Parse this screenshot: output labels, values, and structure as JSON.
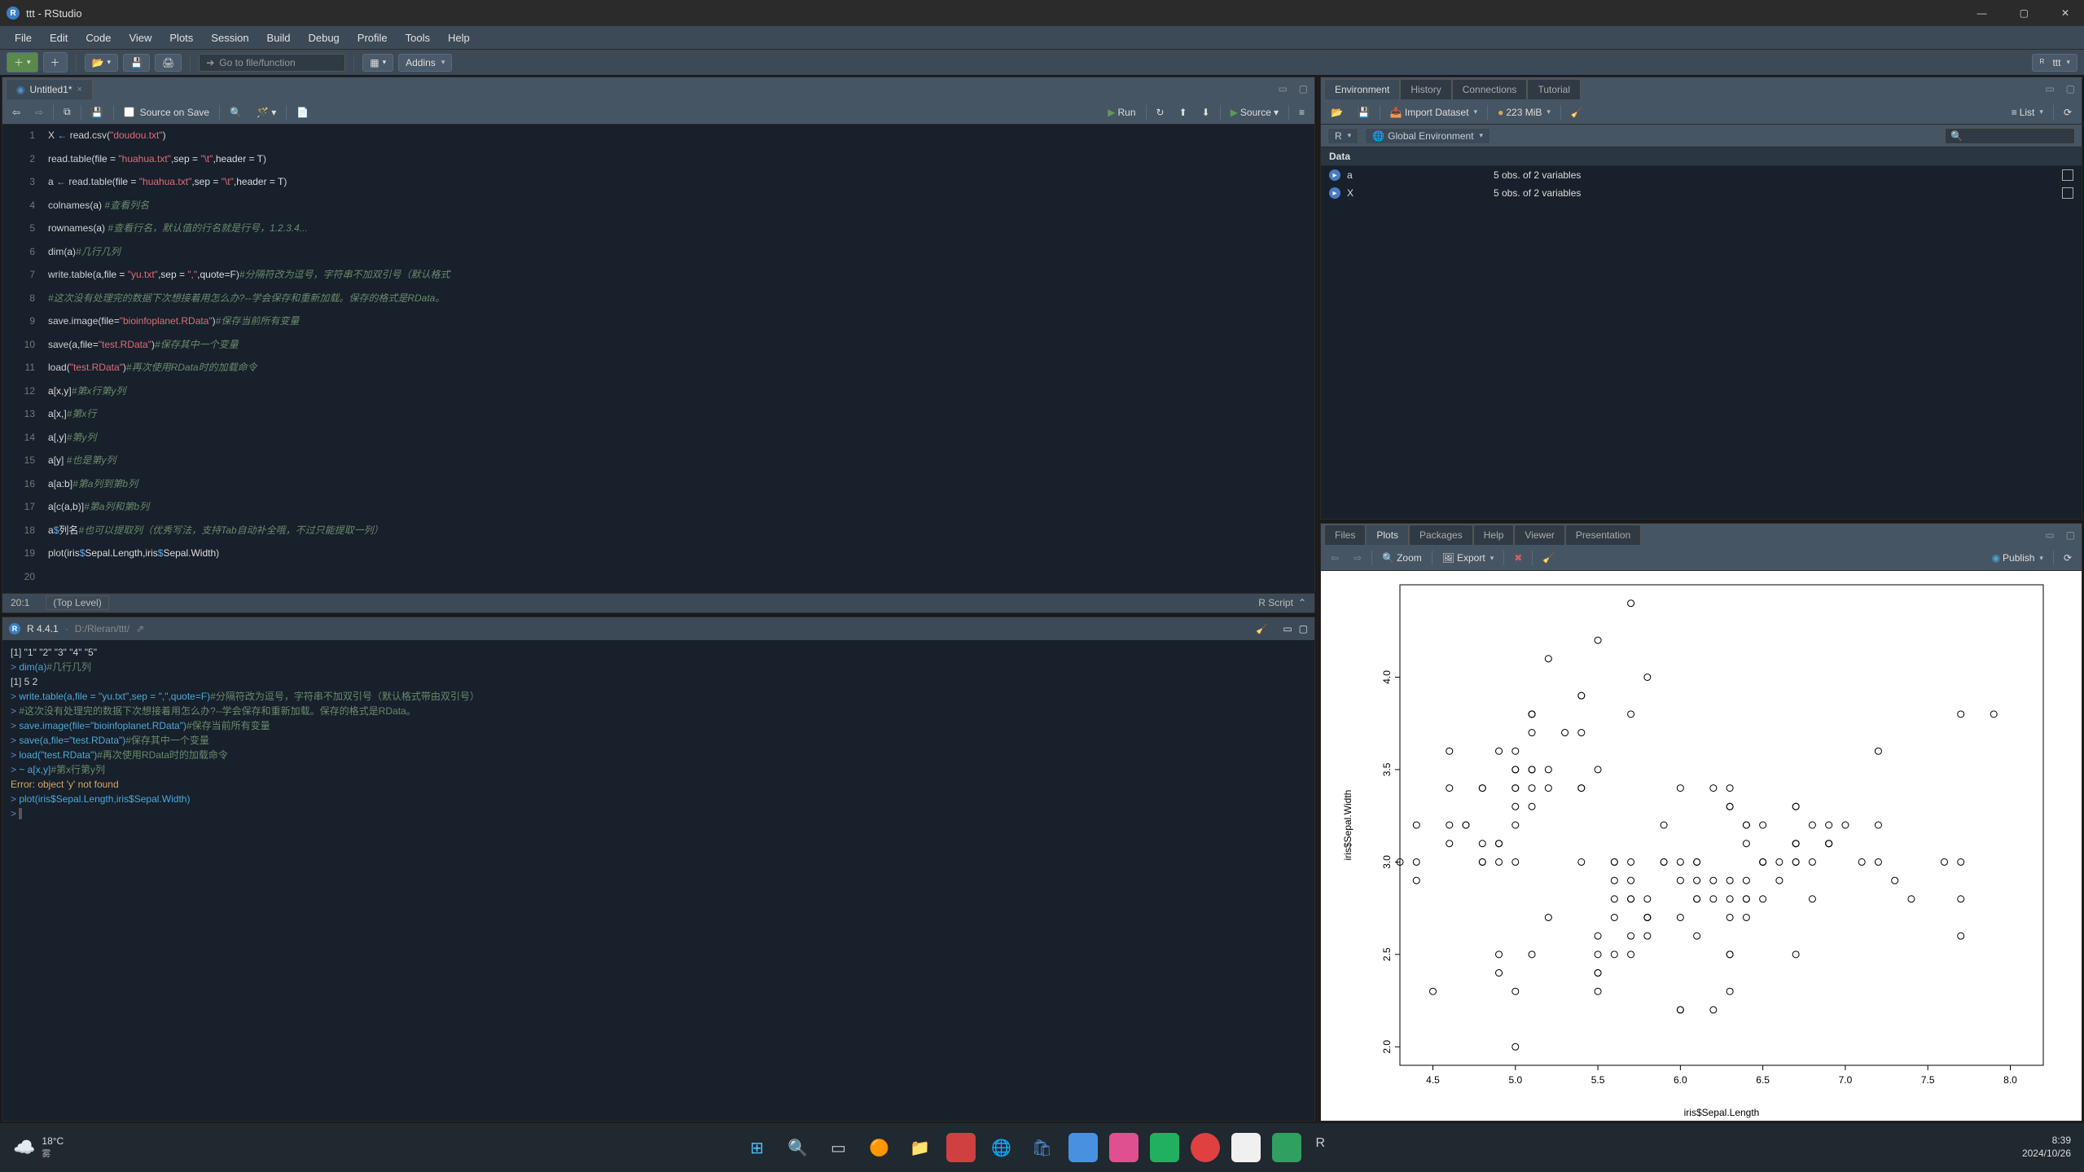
{
  "window": {
    "title": "ttt - RStudio"
  },
  "menu": [
    "File",
    "Edit",
    "Code",
    "View",
    "Plots",
    "Session",
    "Build",
    "Debug",
    "Profile",
    "Tools",
    "Help"
  ],
  "toolbar": {
    "goto_placeholder": "Go to file/function",
    "addins": "Addins",
    "project": "ttt"
  },
  "source": {
    "tab": "Untitled1*",
    "save_on_source": "Source on Save",
    "run": "Run",
    "source_btn": "Source",
    "status_pos": "20:1",
    "status_scope": "(Top Level)",
    "status_type": "R Script",
    "lines": [
      {
        "n": 1,
        "html": "<span class='c-kw'>X</span> <span class='c-op'>←</span> <span class='c-fn'>read.csv</span><span class='c-par'>(</span><span class='c-str'>\"doudou.txt\"</span><span class='c-par'>)</span>"
      },
      {
        "n": 2,
        "html": "<span class='c-fn'>read.table</span><span class='c-par'>(</span>file = <span class='c-str'>\"huahua.txt\"</span>,sep = <span class='c-str'>\"\\t\"</span>,header = T<span class='c-par'>)</span>"
      },
      {
        "n": 3,
        "html": "<span class='c-kw'>a</span> <span class='c-op'>←</span> <span class='c-fn'>read.table</span><span class='c-par'>(</span>file = <span class='c-str'>\"huahua.txt\"</span>,sep = <span class='c-str'>\"\\t\"</span>,header = T<span class='c-par'>)</span>"
      },
      {
        "n": 4,
        "html": "<span class='c-fn'>colnames</span><span class='c-par'>(</span>a<span class='c-par'>)</span> <span class='c-cmt'>#查看列名</span>"
      },
      {
        "n": 5,
        "html": "<span class='c-fn'>rownames</span><span class='c-par'>(</span>a<span class='c-par'>)</span> <span class='c-cmt'>#查看行名，默认值的行名就是行号，1.2.3.4...</span>"
      },
      {
        "n": 6,
        "html": "<span class='c-fn'>dim</span><span class='c-par'>(</span>a<span class='c-par'>)</span><span class='c-cmt'>#几行几列</span>"
      },
      {
        "n": 7,
        "html": "<span class='c-fn'>write.table</span><span class='c-par'>(</span>a,file = <span class='c-str'>\"yu.txt\"</span>,sep = <span class='c-str'>\",\"</span>,quote=F<span class='c-par'>)</span><span class='c-cmt'>#分隔符改为逗号，字符串不加双引号（默认格式</span>"
      },
      {
        "n": 8,
        "html": "<span class='c-cmt'>#这次没有处理完的数据下次想接着用怎么办?--学会保存和重新加载。保存的格式是RData。</span>"
      },
      {
        "n": 9,
        "html": "<span class='c-fn'>save.image</span><span class='c-par'>(</span>file=<span class='c-str'>\"bioinfoplanet.RData\"</span><span class='c-par'>)</span><span class='c-cmt'>#保存当前所有变量</span>"
      },
      {
        "n": 10,
        "html": "<span class='c-fn'>save</span><span class='c-par'>(</span>a,file=<span class='c-str'>\"test.RData\"</span><span class='c-par'>)</span><span class='c-cmt'>#保存其中一个变量</span>"
      },
      {
        "n": 11,
        "html": "<span class='c-fn'>load</span><span class='c-par'>(</span><span class='c-str'>\"test.RData\"</span><span class='c-par'>)</span><span class='c-cmt'>#再次使用RData时的加载命令</span>"
      },
      {
        "n": 12,
        "html": "a<span class='c-par'>[</span>x,y<span class='c-par'>]</span><span class='c-cmt'>#第x行第y列</span>"
      },
      {
        "n": 13,
        "html": "a<span class='c-par'>[</span>x,<span class='c-par'>]</span><span class='c-cmt'>#第x行</span>"
      },
      {
        "n": 14,
        "html": "a<span class='c-par'>[</span>,y<span class='c-par'>]</span><span class='c-cmt'>#第y列</span>"
      },
      {
        "n": 15,
        "html": "a<span class='c-par'>[</span>y<span class='c-par'>]</span> <span class='c-cmt'>#也是第y列</span>"
      },
      {
        "n": 16,
        "html": "a<span class='c-par'>[</span>a:b<span class='c-par'>]</span><span class='c-cmt'>#第a列到第b列</span>"
      },
      {
        "n": 17,
        "html": "a<span class='c-par'>[</span><span class='c-fn'>c</span><span class='c-par'>(</span>a,b<span class='c-par'>)]</span><span class='c-cmt'>#第a列和第b列</span>"
      },
      {
        "n": 18,
        "html": "a<span class='c-op'>$</span>列名<span class='c-cmt'>#也可以提取列（优秀写法，支持Tab自动补全哦，不过只能提取一列）</span>"
      },
      {
        "n": 19,
        "html": "<span class='c-fn'>plot</span><span class='c-par'>(</span>iris<span class='c-op'>$</span>Sepal.Length,iris<span class='c-op'>$</span>Sepal.Width<span class='c-par'>)</span>"
      },
      {
        "n": 20,
        "html": " "
      }
    ]
  },
  "console": {
    "version": "R 4.4.1",
    "path": "D:/Rleran/ttt/",
    "lines_html": "<div class='line out'>[1] \"1\" \"2\" \"3\" \"4\" \"5\"</div><div class='line'><span class='pr'>&gt; </span><span class='cmd-blue'>dim(a)</span><span class='green'>#几行几列</span></div><div class='line out'>[1] 5 2</div><div class='line'><span class='pr'>&gt; </span><span class='cmd-blue'>write.table(a,file = \"yu.txt\",sep = \",\",quote=F)</span><span class='green'>#分隔符改为逗号，字符串不加双引号（默认格式带由双引号）</span></div><div class='line'><span class='pr'>&gt; </span><span class='green'>#这次没有处理完的数据下次想接着用怎么办?--学会保存和重新加载。保存的格式是RData。</span></div><div class='line'><span class='pr'>&gt; </span><span class='cmd-blue'>save.image(file=\"bioinfoplanet.RData\")</span><span class='green'>#保存当前所有变量</span></div><div class='line'><span class='pr'>&gt; </span><span class='cmd-blue'>save(a,file=\"test.RData\")</span><span class='green'>#保存其中一个变量</span></div><div class='line'><span class='pr'>&gt; </span><span class='cmd-blue'>load(\"test.RData\")</span><span class='green'>#再次使用RData时的加载命令</span></div><div class='line'><span class='pr'>&gt; </span><span class='cmd-blue'>~ a[x,y]</span><span class='green'>#第x行第y列</span></div><div class='line err'>Error: object 'y' not found</div><div class='line'><span class='pr'>&gt; </span><span class='cmd-blue'>plot(iris$Sepal.Length,iris$Sepal.Width)</span></div><div class='line'><span class='pr'>&gt; </span><span style='background:#555;'>&nbsp;</span></div>"
  },
  "env": {
    "tabs": [
      "Environment",
      "History",
      "Connections",
      "Tutorial"
    ],
    "import": "Import Dataset",
    "mem": "223 MiB",
    "list": "List",
    "r_label": "R",
    "scope": "Global Environment",
    "section": "Data",
    "rows": [
      {
        "name": "a",
        "desc": "5 obs. of 2 variables"
      },
      {
        "name": "X",
        "desc": "5 obs. of 2 variables"
      }
    ]
  },
  "plots": {
    "tabs": [
      "Files",
      "Plots",
      "Packages",
      "Help",
      "Viewer",
      "Presentation"
    ],
    "zoom": "Zoom",
    "export": "Export",
    "publish": "Publish"
  },
  "chart_data": {
    "type": "scatter",
    "xlabel": "iris$Sepal.Length",
    "ylabel": "iris$Sepal.Width",
    "xlim": [
      4.3,
      8.2
    ],
    "ylim": [
      1.9,
      4.5
    ],
    "xticks": [
      4.5,
      5.0,
      5.5,
      6.0,
      6.5,
      7.0,
      7.5,
      8.0
    ],
    "yticks": [
      2.0,
      2.5,
      3.0,
      3.5,
      4.0
    ],
    "points": [
      [
        5.1,
        3.5
      ],
      [
        4.9,
        3.0
      ],
      [
        4.7,
        3.2
      ],
      [
        4.6,
        3.1
      ],
      [
        5.0,
        3.6
      ],
      [
        5.4,
        3.9
      ],
      [
        4.6,
        3.4
      ],
      [
        5.0,
        3.4
      ],
      [
        4.4,
        2.9
      ],
      [
        4.9,
        3.1
      ],
      [
        5.4,
        3.7
      ],
      [
        4.8,
        3.4
      ],
      [
        4.8,
        3.0
      ],
      [
        4.3,
        3.0
      ],
      [
        5.8,
        4.0
      ],
      [
        5.7,
        4.4
      ],
      [
        5.4,
        3.9
      ],
      [
        5.1,
        3.5
      ],
      [
        5.7,
        3.8
      ],
      [
        5.1,
        3.8
      ],
      [
        5.4,
        3.4
      ],
      [
        5.1,
        3.7
      ],
      [
        4.6,
        3.6
      ],
      [
        5.1,
        3.3
      ],
      [
        4.8,
        3.4
      ],
      [
        5.0,
        3.0
      ],
      [
        5.0,
        3.4
      ],
      [
        5.2,
        3.5
      ],
      [
        5.2,
        3.4
      ],
      [
        4.7,
        3.2
      ],
      [
        4.8,
        3.1
      ],
      [
        5.4,
        3.4
      ],
      [
        5.2,
        4.1
      ],
      [
        5.5,
        4.2
      ],
      [
        4.9,
        3.1
      ],
      [
        5.0,
        3.2
      ],
      [
        5.5,
        3.5
      ],
      [
        4.9,
        3.6
      ],
      [
        4.4,
        3.0
      ],
      [
        5.1,
        3.4
      ],
      [
        5.0,
        3.5
      ],
      [
        4.5,
        2.3
      ],
      [
        4.4,
        3.2
      ],
      [
        5.0,
        3.5
      ],
      [
        5.1,
        3.8
      ],
      [
        4.8,
        3.0
      ],
      [
        5.1,
        3.8
      ],
      [
        4.6,
        3.2
      ],
      [
        5.3,
        3.7
      ],
      [
        5.0,
        3.3
      ],
      [
        7.0,
        3.2
      ],
      [
        6.4,
        3.2
      ],
      [
        6.9,
        3.1
      ],
      [
        5.5,
        2.3
      ],
      [
        6.5,
        2.8
      ],
      [
        5.7,
        2.8
      ],
      [
        6.3,
        3.3
      ],
      [
        4.9,
        2.4
      ],
      [
        6.6,
        2.9
      ],
      [
        5.2,
        2.7
      ],
      [
        5.0,
        2.0
      ],
      [
        5.9,
        3.0
      ],
      [
        6.0,
        2.2
      ],
      [
        6.1,
        2.9
      ],
      [
        5.6,
        2.9
      ],
      [
        6.7,
        3.1
      ],
      [
        5.6,
        3.0
      ],
      [
        5.8,
        2.7
      ],
      [
        6.2,
        2.2
      ],
      [
        5.6,
        2.5
      ],
      [
        5.9,
        3.2
      ],
      [
        6.1,
        2.8
      ],
      [
        6.3,
        2.5
      ],
      [
        6.1,
        2.8
      ],
      [
        6.4,
        2.9
      ],
      [
        6.6,
        3.0
      ],
      [
        6.8,
        2.8
      ],
      [
        6.7,
        3.0
      ],
      [
        6.0,
        2.9
      ],
      [
        5.7,
        2.6
      ],
      [
        5.5,
        2.4
      ],
      [
        5.5,
        2.4
      ],
      [
        5.8,
        2.7
      ],
      [
        6.0,
        2.7
      ],
      [
        5.4,
        3.0
      ],
      [
        6.0,
        3.4
      ],
      [
        6.7,
        3.1
      ],
      [
        6.3,
        2.3
      ],
      [
        5.6,
        3.0
      ],
      [
        5.5,
        2.5
      ],
      [
        5.5,
        2.6
      ],
      [
        6.1,
        3.0
      ],
      [
        5.8,
        2.6
      ],
      [
        5.0,
        2.3
      ],
      [
        5.6,
        2.7
      ],
      [
        5.7,
        3.0
      ],
      [
        5.7,
        2.9
      ],
      [
        6.2,
        2.9
      ],
      [
        5.1,
        2.5
      ],
      [
        5.7,
        2.8
      ],
      [
        6.3,
        3.3
      ],
      [
        5.8,
        2.7
      ],
      [
        7.1,
        3.0
      ],
      [
        6.3,
        2.9
      ],
      [
        6.5,
        3.0
      ],
      [
        7.6,
        3.0
      ],
      [
        4.9,
        2.5
      ],
      [
        7.3,
        2.9
      ],
      [
        6.7,
        2.5
      ],
      [
        7.2,
        3.6
      ],
      [
        6.5,
        3.2
      ],
      [
        6.4,
        2.7
      ],
      [
        6.8,
        3.0
      ],
      [
        5.7,
        2.5
      ],
      [
        5.8,
        2.8
      ],
      [
        6.4,
        3.2
      ],
      [
        6.5,
        3.0
      ],
      [
        7.7,
        3.8
      ],
      [
        7.7,
        2.6
      ],
      [
        6.0,
        2.2
      ],
      [
        6.9,
        3.2
      ],
      [
        5.6,
        2.8
      ],
      [
        7.7,
        2.8
      ],
      [
        6.3,
        2.7
      ],
      [
        6.7,
        3.3
      ],
      [
        7.2,
        3.2
      ],
      [
        6.2,
        2.8
      ],
      [
        6.1,
        3.0
      ],
      [
        6.4,
        2.8
      ],
      [
        7.2,
        3.0
      ],
      [
        7.4,
        2.8
      ],
      [
        7.9,
        3.8
      ],
      [
        6.4,
        2.8
      ],
      [
        6.3,
        2.8
      ],
      [
        6.1,
        2.6
      ],
      [
        7.7,
        3.0
      ],
      [
        6.3,
        3.4
      ],
      [
        6.4,
        3.1
      ],
      [
        6.0,
        3.0
      ],
      [
        6.9,
        3.1
      ],
      [
        6.7,
        3.1
      ],
      [
        6.9,
        3.1
      ],
      [
        5.8,
        2.7
      ],
      [
        6.8,
        3.2
      ],
      [
        6.7,
        3.3
      ],
      [
        6.7,
        3.0
      ],
      [
        6.3,
        2.5
      ],
      [
        6.5,
        3.0
      ],
      [
        6.2,
        3.4
      ],
      [
        5.9,
        3.0
      ]
    ]
  },
  "taskbar": {
    "temp": "18°C",
    "weather": "雾",
    "time": "8:39",
    "date": "2024/10/26"
  }
}
